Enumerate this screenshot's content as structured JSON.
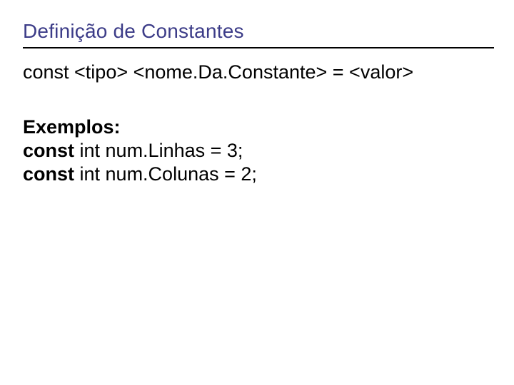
{
  "title": "Definição de Constantes",
  "syntax": "const <tipo> <nome.Da.Constante> = <valor>",
  "examplesHeading": "Exemplos:",
  "examples": [
    {
      "kw": "const",
      "rest": " int num.Linhas = 3;"
    },
    {
      "kw": "const",
      "rest": " int num.Colunas = 2;"
    }
  ]
}
